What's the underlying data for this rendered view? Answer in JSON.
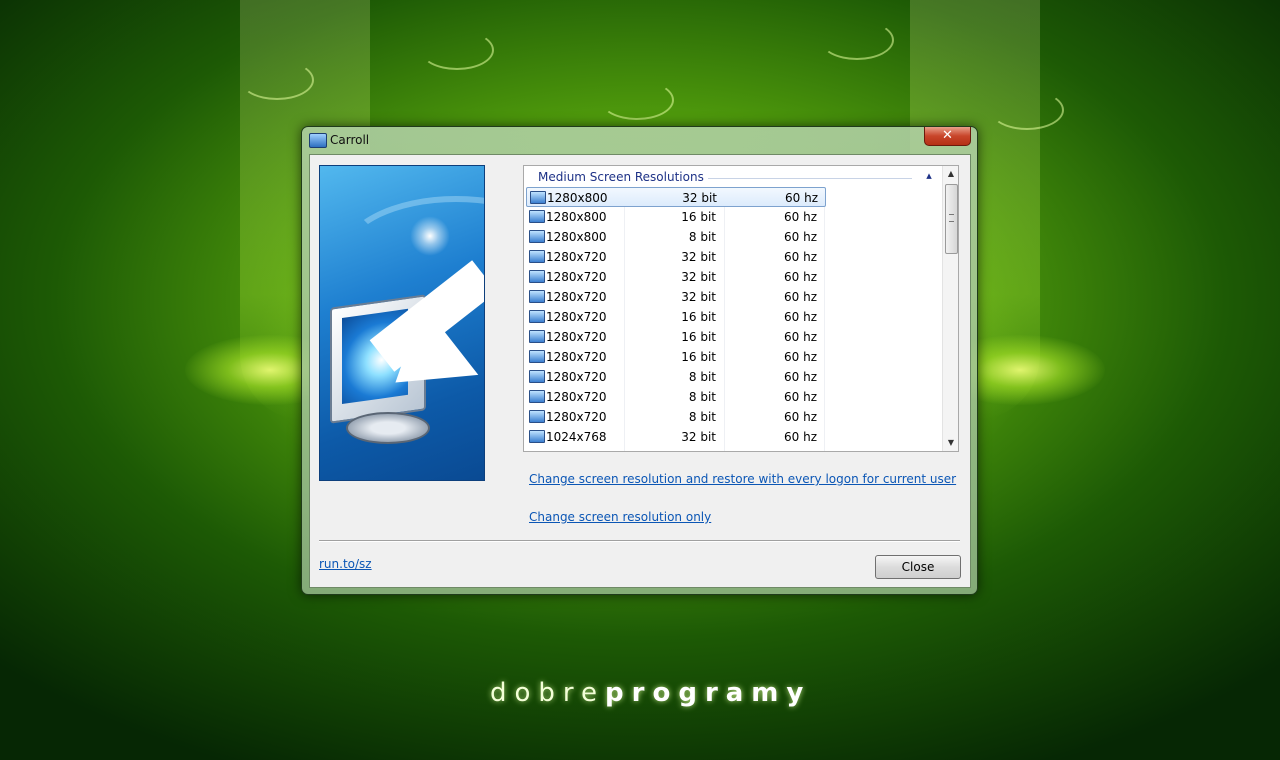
{
  "desktop": {
    "brand_light": "dobre",
    "brand_bold": "programy"
  },
  "window": {
    "title": "Carroll",
    "close_glyph": "✕",
    "title_icon": "monitor-icon"
  },
  "list": {
    "group_title": "Medium Screen Resolutions",
    "collapse_glyph": "▴",
    "rows": [
      {
        "resolution": "1280x800",
        "bits": "32 bit",
        "hz": "60 hz",
        "selected": true
      },
      {
        "resolution": "1280x800",
        "bits": "16 bit",
        "hz": "60 hz"
      },
      {
        "resolution": "1280x800",
        "bits": "8 bit",
        "hz": "60 hz"
      },
      {
        "resolution": "1280x720",
        "bits": "32 bit",
        "hz": "60 hz"
      },
      {
        "resolution": "1280x720",
        "bits": "32 bit",
        "hz": "60 hz"
      },
      {
        "resolution": "1280x720",
        "bits": "32 bit",
        "hz": "60 hz"
      },
      {
        "resolution": "1280x720",
        "bits": "16 bit",
        "hz": "60 hz"
      },
      {
        "resolution": "1280x720",
        "bits": "16 bit",
        "hz": "60 hz"
      },
      {
        "resolution": "1280x720",
        "bits": "16 bit",
        "hz": "60 hz"
      },
      {
        "resolution": "1280x720",
        "bits": "8 bit",
        "hz": "60 hz"
      },
      {
        "resolution": "1280x720",
        "bits": "8 bit",
        "hz": "60 hz"
      },
      {
        "resolution": "1280x720",
        "bits": "8 bit",
        "hz": "60 hz"
      },
      {
        "resolution": "1024x768",
        "bits": "32 bit",
        "hz": "60 hz"
      }
    ],
    "scroll_up_glyph": "▲",
    "scroll_down_glyph": "▼"
  },
  "links": {
    "restore": "Change screen resolution and restore with every logon for current user",
    "only": "Change screen resolution only",
    "site": "run.to/sz"
  },
  "buttons": {
    "close_label": "Close"
  },
  "colors": {
    "link": "#0b56b5",
    "group_header": "#1e3287",
    "close_button_red": "#c8452a"
  }
}
